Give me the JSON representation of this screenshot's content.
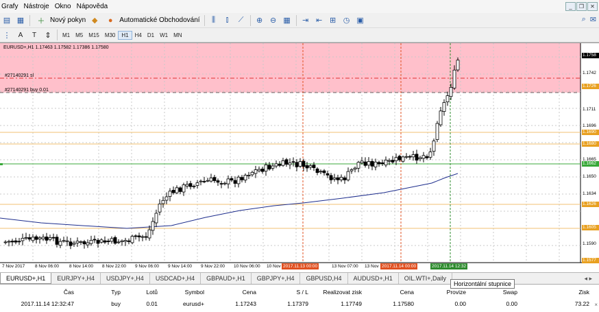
{
  "menu": {
    "items": [
      "Grafy",
      "Nástroje",
      "Okno",
      "Nápověda"
    ]
  },
  "toolbar": {
    "new_order_label": "Nový pokyn",
    "auto_trading_label": "Automatické Obchodování",
    "timeframes": [
      "M1",
      "M5",
      "M15",
      "M30",
      "H1",
      "H4",
      "D1",
      "W1",
      "MN"
    ],
    "active_timeframe": "H1"
  },
  "chart": {
    "header": "EURUSD+,H1  1.17463 1.17582 1.17386 1.17580",
    "sl_label": "#27140291 sl",
    "buy_label": "#27140291 buy 0.01",
    "price_labels": [
      "1.1758",
      "1.1742",
      "1.1726",
      "1.1711",
      "1.1696",
      "1.1690",
      "1.1680",
      "1.1665",
      "1.1662",
      "1.1650",
      "1.1634",
      "1.1626",
      "1.1605",
      "1.1590",
      "1.1577"
    ],
    "time_labels": [
      "7 Nov 2017",
      "8 Nov 06:00",
      "8 Nov 14:00",
      "8 Nov 22:00",
      "9 Nov 06:00",
      "9 Nov 14:00",
      "9 Nov 22:00",
      "10 Nov 06:00",
      "10 Nov",
      "2017.11.13 00:00",
      "13 Nov 07:00",
      "13 Nov",
      "2017.11.14 00:00",
      "2017.11.14 12:32"
    ],
    "colors": {
      "sl_zone": "#ffc0cb",
      "sl_line": "#e03030",
      "buy_line": "#38a838",
      "level": "#e8a020",
      "ma": "#1c2c8c",
      "separator": "#e05020",
      "cursor": "#2e8b2e"
    }
  },
  "tabs": {
    "items": [
      "EURUSD+,H1",
      "EURJPY+,H4",
      "USDJPY+,H4",
      "USDCAD+,H4",
      "GBPAUD+,H1",
      "GBPJPY+,H4",
      "GBPUSD,H4",
      "AUDUSD+,H1",
      "OIL.WTI+,Daily"
    ],
    "active": "EURUSD+,H1"
  },
  "tooltip": "Horizontální stupnice",
  "terminal": {
    "columns": [
      "Čas",
      "Typ",
      "Lotů",
      "Symbol",
      "Cena",
      "S / L",
      "Realizovat zisk",
      "Cena",
      "Provize",
      "Swap",
      "Zisk"
    ],
    "rows": [
      [
        "2017.11.14 12:32:47",
        "buy",
        "0.01",
        "eurusd+",
        "1.17243",
        "1.17379",
        "1.17749",
        "1.17580",
        "0.00",
        "0.00",
        "73.22"
      ]
    ]
  }
}
